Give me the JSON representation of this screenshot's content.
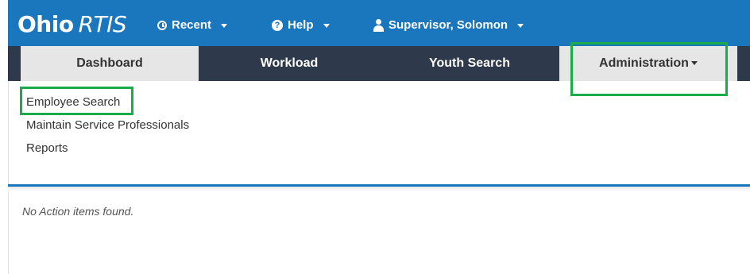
{
  "header": {
    "logo_part1": "Ohio",
    "logo_part2": "RTIS",
    "recent_label": "Recent",
    "help_label": "Help",
    "user_label": "Supervisor, Solomon"
  },
  "tabs": {
    "dashboard": "Dashboard",
    "workload": "Workload",
    "youth_search": "Youth Search",
    "administration": "Administration"
  },
  "admin_menu": {
    "items": [
      "Employee Search",
      "Maintain Service Professionals",
      "Reports"
    ]
  },
  "main": {
    "empty_message": "No Action items found."
  },
  "colors": {
    "header_blue": "#1a76bd",
    "tabbar_dark": "#2e3a4b",
    "highlight_green": "#1aab4a"
  },
  "icons": {
    "recent": "clock-icon",
    "help": "question-circle-icon",
    "user": "user-icon"
  }
}
